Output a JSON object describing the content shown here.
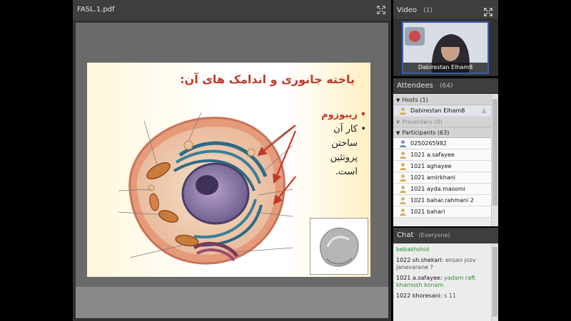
{
  "document": {
    "title": "FASL.1.pdf",
    "slide": {
      "title": "یاخته جانوری و اندامک های آن:",
      "bullets": [
        {
          "text": "ریبوزوم",
          "emphasis": true
        },
        {
          "text": "کار آن ساختن پروتئین است.",
          "emphasis": false
        }
      ],
      "colors": {
        "title": "#c0392b",
        "arrows": "#c0392b"
      }
    }
  },
  "video": {
    "title": "Video",
    "count": "(1)",
    "nameplate": "Dabirestan Elham8"
  },
  "attendees": {
    "title": "Attendees",
    "count": "(64)",
    "sections": {
      "hosts": "Hosts (1)",
      "presenters": "Presenters (0)",
      "participants": "Participants (63)"
    },
    "hosts": [
      {
        "name": "Dabirestan Elham8"
      }
    ],
    "participants": [
      {
        "name": "0250265982"
      },
      {
        "name": "1021 a.safayee"
      },
      {
        "name": "1021 aghayee"
      },
      {
        "name": "1021 amirkhani"
      },
      {
        "name": "1021 ayda.masomi"
      },
      {
        "name": "1021 bahar.rahmani 2"
      },
      {
        "name": "1021 bahari"
      }
    ]
  },
  "chat": {
    "title": "Chat",
    "scope": "(Everyone)",
    "messages": [
      {
        "from": "",
        "text": "bebakhshid",
        "green": true
      },
      {
        "from": "1022 sh.shekari:",
        "text": "ensan jozv janevarane ?",
        "green": false
      },
      {
        "from": "1021 a.safayee:",
        "text": "yadam raft khamosh konam",
        "green": true
      },
      {
        "from": "1022 khoresani:",
        "text": "s 11",
        "green": false
      }
    ]
  }
}
